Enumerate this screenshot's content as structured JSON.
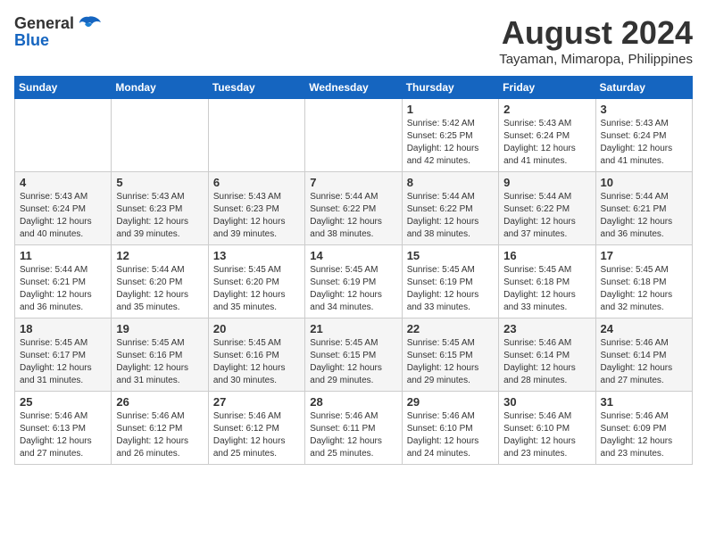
{
  "header": {
    "logo_general": "General",
    "logo_blue": "Blue",
    "month_title": "August 2024",
    "location": "Tayaman, Mimaropa, Philippines"
  },
  "weekdays": [
    "Sunday",
    "Monday",
    "Tuesday",
    "Wednesday",
    "Thursday",
    "Friday",
    "Saturday"
  ],
  "weeks": [
    [
      {
        "day": "",
        "info": ""
      },
      {
        "day": "",
        "info": ""
      },
      {
        "day": "",
        "info": ""
      },
      {
        "day": "",
        "info": ""
      },
      {
        "day": "1",
        "info": "Sunrise: 5:42 AM\nSunset: 6:25 PM\nDaylight: 12 hours\nand 42 minutes."
      },
      {
        "day": "2",
        "info": "Sunrise: 5:43 AM\nSunset: 6:24 PM\nDaylight: 12 hours\nand 41 minutes."
      },
      {
        "day": "3",
        "info": "Sunrise: 5:43 AM\nSunset: 6:24 PM\nDaylight: 12 hours\nand 41 minutes."
      }
    ],
    [
      {
        "day": "4",
        "info": "Sunrise: 5:43 AM\nSunset: 6:24 PM\nDaylight: 12 hours\nand 40 minutes."
      },
      {
        "day": "5",
        "info": "Sunrise: 5:43 AM\nSunset: 6:23 PM\nDaylight: 12 hours\nand 39 minutes."
      },
      {
        "day": "6",
        "info": "Sunrise: 5:43 AM\nSunset: 6:23 PM\nDaylight: 12 hours\nand 39 minutes."
      },
      {
        "day": "7",
        "info": "Sunrise: 5:44 AM\nSunset: 6:22 PM\nDaylight: 12 hours\nand 38 minutes."
      },
      {
        "day": "8",
        "info": "Sunrise: 5:44 AM\nSunset: 6:22 PM\nDaylight: 12 hours\nand 38 minutes."
      },
      {
        "day": "9",
        "info": "Sunrise: 5:44 AM\nSunset: 6:22 PM\nDaylight: 12 hours\nand 37 minutes."
      },
      {
        "day": "10",
        "info": "Sunrise: 5:44 AM\nSunset: 6:21 PM\nDaylight: 12 hours\nand 36 minutes."
      }
    ],
    [
      {
        "day": "11",
        "info": "Sunrise: 5:44 AM\nSunset: 6:21 PM\nDaylight: 12 hours\nand 36 minutes."
      },
      {
        "day": "12",
        "info": "Sunrise: 5:44 AM\nSunset: 6:20 PM\nDaylight: 12 hours\nand 35 minutes."
      },
      {
        "day": "13",
        "info": "Sunrise: 5:45 AM\nSunset: 6:20 PM\nDaylight: 12 hours\nand 35 minutes."
      },
      {
        "day": "14",
        "info": "Sunrise: 5:45 AM\nSunset: 6:19 PM\nDaylight: 12 hours\nand 34 minutes."
      },
      {
        "day": "15",
        "info": "Sunrise: 5:45 AM\nSunset: 6:19 PM\nDaylight: 12 hours\nand 33 minutes."
      },
      {
        "day": "16",
        "info": "Sunrise: 5:45 AM\nSunset: 6:18 PM\nDaylight: 12 hours\nand 33 minutes."
      },
      {
        "day": "17",
        "info": "Sunrise: 5:45 AM\nSunset: 6:18 PM\nDaylight: 12 hours\nand 32 minutes."
      }
    ],
    [
      {
        "day": "18",
        "info": "Sunrise: 5:45 AM\nSunset: 6:17 PM\nDaylight: 12 hours\nand 31 minutes."
      },
      {
        "day": "19",
        "info": "Sunrise: 5:45 AM\nSunset: 6:16 PM\nDaylight: 12 hours\nand 31 minutes."
      },
      {
        "day": "20",
        "info": "Sunrise: 5:45 AM\nSunset: 6:16 PM\nDaylight: 12 hours\nand 30 minutes."
      },
      {
        "day": "21",
        "info": "Sunrise: 5:45 AM\nSunset: 6:15 PM\nDaylight: 12 hours\nand 29 minutes."
      },
      {
        "day": "22",
        "info": "Sunrise: 5:45 AM\nSunset: 6:15 PM\nDaylight: 12 hours\nand 29 minutes."
      },
      {
        "day": "23",
        "info": "Sunrise: 5:46 AM\nSunset: 6:14 PM\nDaylight: 12 hours\nand 28 minutes."
      },
      {
        "day": "24",
        "info": "Sunrise: 5:46 AM\nSunset: 6:14 PM\nDaylight: 12 hours\nand 27 minutes."
      }
    ],
    [
      {
        "day": "25",
        "info": "Sunrise: 5:46 AM\nSunset: 6:13 PM\nDaylight: 12 hours\nand 27 minutes."
      },
      {
        "day": "26",
        "info": "Sunrise: 5:46 AM\nSunset: 6:12 PM\nDaylight: 12 hours\nand 26 minutes."
      },
      {
        "day": "27",
        "info": "Sunrise: 5:46 AM\nSunset: 6:12 PM\nDaylight: 12 hours\nand 25 minutes."
      },
      {
        "day": "28",
        "info": "Sunrise: 5:46 AM\nSunset: 6:11 PM\nDaylight: 12 hours\nand 25 minutes."
      },
      {
        "day": "29",
        "info": "Sunrise: 5:46 AM\nSunset: 6:10 PM\nDaylight: 12 hours\nand 24 minutes."
      },
      {
        "day": "30",
        "info": "Sunrise: 5:46 AM\nSunset: 6:10 PM\nDaylight: 12 hours\nand 23 minutes."
      },
      {
        "day": "31",
        "info": "Sunrise: 5:46 AM\nSunset: 6:09 PM\nDaylight: 12 hours\nand 23 minutes."
      }
    ]
  ]
}
